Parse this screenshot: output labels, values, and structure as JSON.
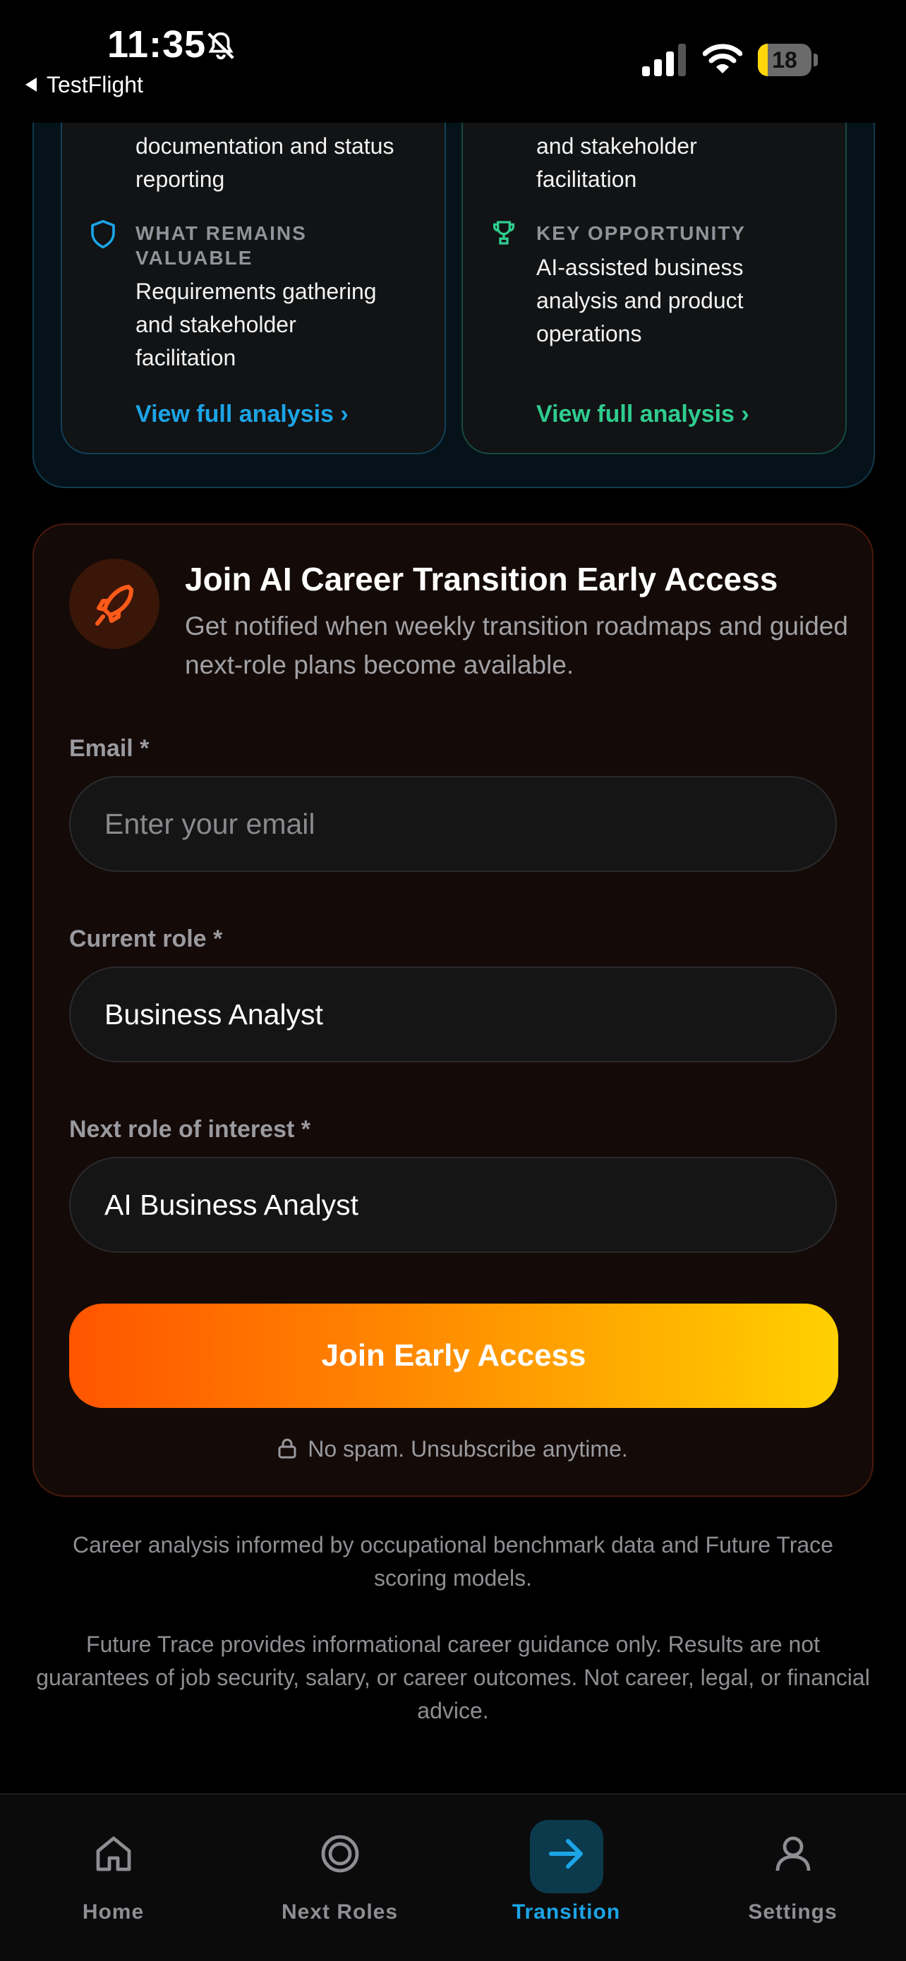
{
  "status_bar": {
    "time": "11:35",
    "back_label": "TestFlight",
    "battery_level": "18",
    "battery_fraction": 0.18
  },
  "analysis_cards": {
    "left": {
      "cut_line": "documentation and status",
      "cut_line2": "reporting",
      "label_line1": "WHAT REMAINS",
      "label_line2": "VALUABLE",
      "body": [
        "Requirements gathering",
        "and stakeholder",
        "facilitation"
      ],
      "link": "View full analysis ›",
      "accent": "#1ca4e6",
      "icon": "shield-icon"
    },
    "right": {
      "cut_line": "and stakeholder",
      "cut_line2": "facilitation",
      "label_line1": "KEY OPPORTUNITY",
      "body": [
        "AI-assisted business",
        "analysis and product",
        "operations"
      ],
      "link": "View full analysis ›",
      "accent": "#2fcc8f",
      "icon": "trophy-icon"
    }
  },
  "early_access": {
    "title": "Join AI Career Transition Early Access",
    "subtitle": "Get notified when weekly transition roadmaps and guided next-role plans become available.",
    "email": {
      "label": "Email *",
      "placeholder": "Enter your email"
    },
    "current_role": {
      "label": "Current role *",
      "value": "Business Analyst"
    },
    "next_role": {
      "label": "Next role of interest *",
      "value": "AI Business Analyst"
    },
    "cta": "Join Early Access",
    "no_spam": "No spam. Unsubscribe anytime.",
    "accent": "#ff5a1a",
    "icon": "rocket-icon"
  },
  "footer": {
    "data_note": "Career analysis informed by occupational benchmark data and Future Trace scoring models.",
    "disclaimer": "Future Trace provides informational career guidance only. Results are not guarantees of job security, salary, or career outcomes. Not career, legal, or financial advice."
  },
  "tabs": [
    {
      "label": "Home",
      "icon": "home-icon",
      "active": false
    },
    {
      "label": "Next Roles",
      "icon": "target-icon",
      "active": false
    },
    {
      "label": "Transition",
      "icon": "arrow-right-icon",
      "active": true
    },
    {
      "label": "Settings",
      "icon": "person-icon",
      "active": false
    }
  ],
  "colors": {
    "active_tab": "#1ca4e6",
    "cta_start": "#ff5500",
    "cta_end": "#ffd000"
  }
}
